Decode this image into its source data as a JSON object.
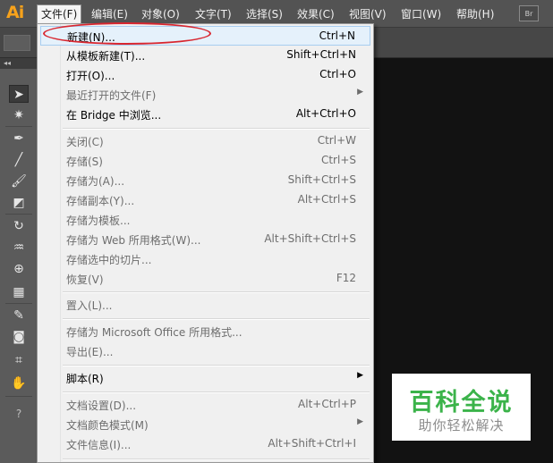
{
  "app": {
    "logo": "Ai"
  },
  "menubar": {
    "items": [
      "文件(F)",
      "编辑(E)",
      "对象(O)",
      "文字(T)",
      "选择(S)",
      "效果(C)",
      "视图(V)",
      "窗口(W)",
      "帮助(H)"
    ],
    "bridge_button": "Br"
  },
  "toolbar": {
    "collapse": "◂◂",
    "tools": [
      {
        "icon": "selection-arrow-icon",
        "glyph": "➤"
      },
      {
        "icon": "magic-wand-icon",
        "glyph": "✷"
      },
      {
        "icon": "pen-icon",
        "glyph": "✒"
      },
      {
        "icon": "line-segment-icon",
        "glyph": "╱"
      },
      {
        "icon": "paintbrush-icon",
        "glyph": "🖌"
      },
      {
        "icon": "eraser-icon",
        "glyph": "◩"
      },
      {
        "icon": "rotate-icon",
        "glyph": "↻"
      },
      {
        "icon": "warp-icon",
        "glyph": "♒"
      },
      {
        "icon": "shape-builder-icon",
        "glyph": "⊕"
      },
      {
        "icon": "perspective-grid-icon",
        "glyph": "▦"
      },
      {
        "icon": "eyedropper-icon",
        "glyph": "✎"
      },
      {
        "icon": "symbol-sprayer-icon",
        "glyph": "◙"
      },
      {
        "icon": "artboard-icon",
        "glyph": "⌗"
      },
      {
        "icon": "hand-icon",
        "glyph": "✋"
      },
      {
        "icon": "help-icon",
        "glyph": "?"
      }
    ]
  },
  "file_menu": {
    "items": [
      {
        "label": "新建(N)...",
        "shortcut": "Ctrl+N",
        "enabled": true,
        "submenu": false
      },
      {
        "label": "从模板新建(T)...",
        "shortcut": "Shift+Ctrl+N",
        "enabled": true,
        "submenu": false
      },
      {
        "label": "打开(O)...",
        "shortcut": "Ctrl+O",
        "enabled": true,
        "submenu": false
      },
      {
        "label": "最近打开的文件(F)",
        "shortcut": "",
        "enabled": false,
        "submenu": true
      },
      {
        "label": "在 Bridge 中浏览...",
        "shortcut": "Alt+Ctrl+O",
        "enabled": true,
        "submenu": false
      },
      {
        "label": "关闭(C)",
        "shortcut": "Ctrl+W",
        "enabled": false,
        "submenu": false
      },
      {
        "label": "存储(S)",
        "shortcut": "Ctrl+S",
        "enabled": false,
        "submenu": false
      },
      {
        "label": "存储为(A)...",
        "shortcut": "Shift+Ctrl+S",
        "enabled": false,
        "submenu": false
      },
      {
        "label": "存储副本(Y)...",
        "shortcut": "Alt+Ctrl+S",
        "enabled": false,
        "submenu": false
      },
      {
        "label": "存储为模板...",
        "shortcut": "",
        "enabled": false,
        "submenu": false
      },
      {
        "label": "存储为 Web 所用格式(W)...",
        "shortcut": "Alt+Shift+Ctrl+S",
        "enabled": false,
        "submenu": false
      },
      {
        "label": "存储选中的切片...",
        "shortcut": "",
        "enabled": false,
        "submenu": false
      },
      {
        "label": "恢复(V)",
        "shortcut": "F12",
        "enabled": false,
        "submenu": false
      },
      {
        "label": "置入(L)...",
        "shortcut": "",
        "enabled": false,
        "submenu": false
      },
      {
        "label": "存储为 Microsoft Office 所用格式...",
        "shortcut": "",
        "enabled": false,
        "submenu": false
      },
      {
        "label": "导出(E)...",
        "shortcut": "",
        "enabled": false,
        "submenu": false
      },
      {
        "label": "脚本(R)",
        "shortcut": "",
        "enabled": true,
        "submenu": true
      },
      {
        "label": "文档设置(D)...",
        "shortcut": "Alt+Ctrl+P",
        "enabled": false,
        "submenu": false
      },
      {
        "label": "文档颜色模式(M)",
        "shortcut": "",
        "enabled": false,
        "submenu": true
      },
      {
        "label": "文件信息(I)...",
        "shortcut": "Alt+Shift+Ctrl+I",
        "enabled": false,
        "submenu": false
      }
    ]
  },
  "watermark": {
    "line1": "百科全说",
    "line2": "助你轻松解决"
  },
  "colors": {
    "accent_logo": "#f7a21b",
    "annotation": "#d8262f",
    "watermark_green": "#3bb34a"
  }
}
